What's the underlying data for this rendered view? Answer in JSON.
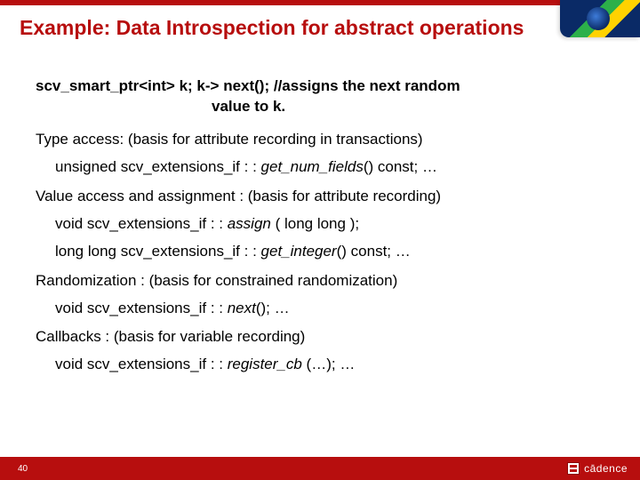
{
  "title": "Example: Data Introspection for abstract operations",
  "lead": {
    "l1": "scv_smart_ptr<int> k;   k-> next();  //assigns the next random",
    "l2": "value to k."
  },
  "sections": {
    "type_access": {
      "heading": "Type access: (basis for attribute recording in transactions)",
      "sub_pre": "unsigned scv_extensions_if : : ",
      "sub_em": "get_num_fields",
      "sub_post": "() const; …"
    },
    "value_access": {
      "heading": "Value access and assignment : (basis for attribute recording)",
      "sub1_pre": "void scv_extensions_if : : ",
      "sub1_em": "assign",
      "sub1_post": " ( long long );",
      "sub2_pre": "long long scv_extensions_if : : ",
      "sub2_em": "get_integer",
      "sub2_post": "() const; …"
    },
    "randomization": {
      "heading": "Randomization : (basis for constrained randomization)",
      "sub_pre": "void scv_extensions_if : : ",
      "sub_em": "next",
      "sub_post": "(); …"
    },
    "callbacks": {
      "heading": "Callbacks : (basis for variable recording)",
      "sub_pre": "void scv_extensions_if : : ",
      "sub_em": "register_cb",
      "sub_post": " (…); …"
    }
  },
  "footer": {
    "page": "40",
    "brand": "cādence"
  }
}
